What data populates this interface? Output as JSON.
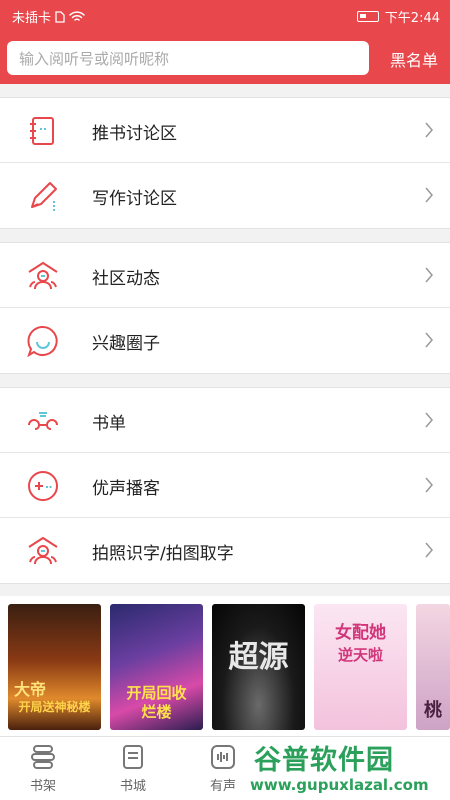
{
  "status_bar": {
    "carrier": "未插卡",
    "time": "下午2:44"
  },
  "header": {
    "search_placeholder": "输入阅听号或阅听昵称",
    "blacklist_label": "黑名单"
  },
  "groups": [
    {
      "items": [
        {
          "label": "推书讨论区",
          "icon": "notebook-icon"
        },
        {
          "label": "写作讨论区",
          "icon": "pencil-icon"
        }
      ]
    },
    {
      "items": [
        {
          "label": "社区动态",
          "icon": "community-icon"
        },
        {
          "label": "兴趣圈子",
          "icon": "chat-bubble-icon"
        }
      ]
    },
    {
      "items": [
        {
          "label": "书单",
          "icon": "booklist-icon"
        },
        {
          "label": "优声播客",
          "icon": "podcast-icon"
        },
        {
          "label": "拍照识字/拍图取字",
          "icon": "camera-text-icon"
        }
      ]
    }
  ],
  "covers": [
    {
      "title": "大帝",
      "subtitle": "开局送神秘楼"
    },
    {
      "title": "开局回收",
      "subtitle": "烂楼"
    },
    {
      "title": "超源",
      "subtitle": ""
    },
    {
      "title": "女配她",
      "subtitle": "逆天啦"
    },
    {
      "title": "桃",
      "subtitle": ""
    }
  ],
  "tabs": [
    {
      "label": "书架",
      "icon": "bookshelf-icon"
    },
    {
      "label": "书城",
      "icon": "bookstore-icon"
    },
    {
      "label": "有声",
      "icon": "audio-icon"
    }
  ],
  "watermark": {
    "line1": "谷普软件园",
    "line2": "www.gupuxlazal.com"
  },
  "colors": {
    "accent": "#e8474c",
    "watermark": "#2aa05a"
  }
}
